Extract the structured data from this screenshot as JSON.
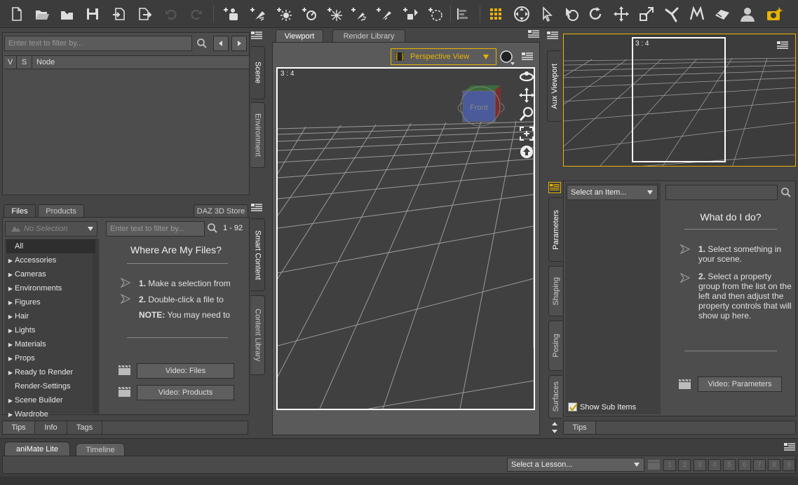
{
  "toolbar": {
    "icons": [
      "new-icon",
      "open-icon",
      "merge-icon",
      "save-icon",
      "import-icon",
      "export-icon",
      "undo-icon",
      "redo-icon",
      "new-figure-icon",
      "new-spotlight-icon",
      "new-point-light-icon",
      "new-distant-light-icon",
      "new-linear-light-icon",
      "new-spot-icon",
      "new-uber-light-icon",
      "new-primitive-icon",
      "new-null-icon",
      "align-icon",
      "active-pose-icon",
      "universal-tool-icon",
      "node-selection-icon",
      "region-navigator-icon",
      "rotate-tool-icon",
      "translate-tool-icon",
      "scale-tool-icon",
      "joint-editor-icon",
      "geometry-editor-icon",
      "surface-selection-icon",
      "figure-icon",
      "render-icon"
    ]
  },
  "scene_panel": {
    "filter_placeholder": "Enter text to filter by...",
    "columns": [
      "V",
      "S",
      "Node"
    ],
    "side_tabs": [
      "Scene",
      "Environment"
    ]
  },
  "content_panel": {
    "tabs": [
      "Files",
      "Products",
      "DAZ 3D Store"
    ],
    "selection_placeholder": "No Selection",
    "filter_placeholder": "Enter text to filter by...",
    "count": "1 - 92",
    "categories": [
      {
        "label": "All",
        "expandable": false,
        "selected": true
      },
      {
        "label": "Accessories",
        "expandable": true
      },
      {
        "label": "Cameras",
        "expandable": true
      },
      {
        "label": "Environments",
        "expandable": true
      },
      {
        "label": "Figures",
        "expandable": true
      },
      {
        "label": "Hair",
        "expandable": true
      },
      {
        "label": "Lights",
        "expandable": true
      },
      {
        "label": "Materials",
        "expandable": true
      },
      {
        "label": "Props",
        "expandable": true
      },
      {
        "label": "Ready to Render",
        "expandable": true
      },
      {
        "label": "Render-Settings",
        "expandable": false
      },
      {
        "label": "Scene Builder",
        "expandable": true
      },
      {
        "label": "Wardrobe",
        "expandable": true
      }
    ],
    "help_title": "Where Are My Files?",
    "help_steps": [
      {
        "num": "1.",
        "text": "Make a selection from"
      },
      {
        "num": "2.",
        "text": "Double-click a file to"
      }
    ],
    "note_label": "NOTE:",
    "note_text": "You may need to",
    "video_files": "Video: Files",
    "video_products": "Video:  Products",
    "side_tabs": [
      "Smart Content",
      "Content Library"
    ],
    "bottom_tabs": [
      "Tips",
      "Info",
      "Tags"
    ]
  },
  "viewport": {
    "tabs": [
      "Viewport",
      "Render Library"
    ],
    "view_select": "Perspective View",
    "ratio": "3 : 4",
    "cube_label": "Front",
    "accent": "#e8b400"
  },
  "aux_viewport": {
    "tab": "Aux Viewport",
    "ratio": "3 : 4"
  },
  "parameters_panel": {
    "side_tabs": [
      "Parameters",
      "Shaping",
      "Posing",
      "Surfaces"
    ],
    "select_item": "Select an Item...",
    "show_sub_items": "Show Sub Items",
    "help_title": "What do I do?",
    "steps": [
      {
        "num": "1.",
        "text": "Select something in your scene."
      },
      {
        "num": "2.",
        "text": "Select a property group from the list on the left and then adjust the property controls that will show up here."
      }
    ],
    "video": "Video: Parameters",
    "bottom_tab": "Tips"
  },
  "timeline_panel": {
    "tabs": [
      "aniMate Lite",
      "Timeline"
    ],
    "lesson_select": "Select a Lesson...",
    "lesson_numbers": [
      "1",
      "2",
      "3",
      "4",
      "5",
      "6",
      "7",
      "8",
      "9"
    ]
  }
}
